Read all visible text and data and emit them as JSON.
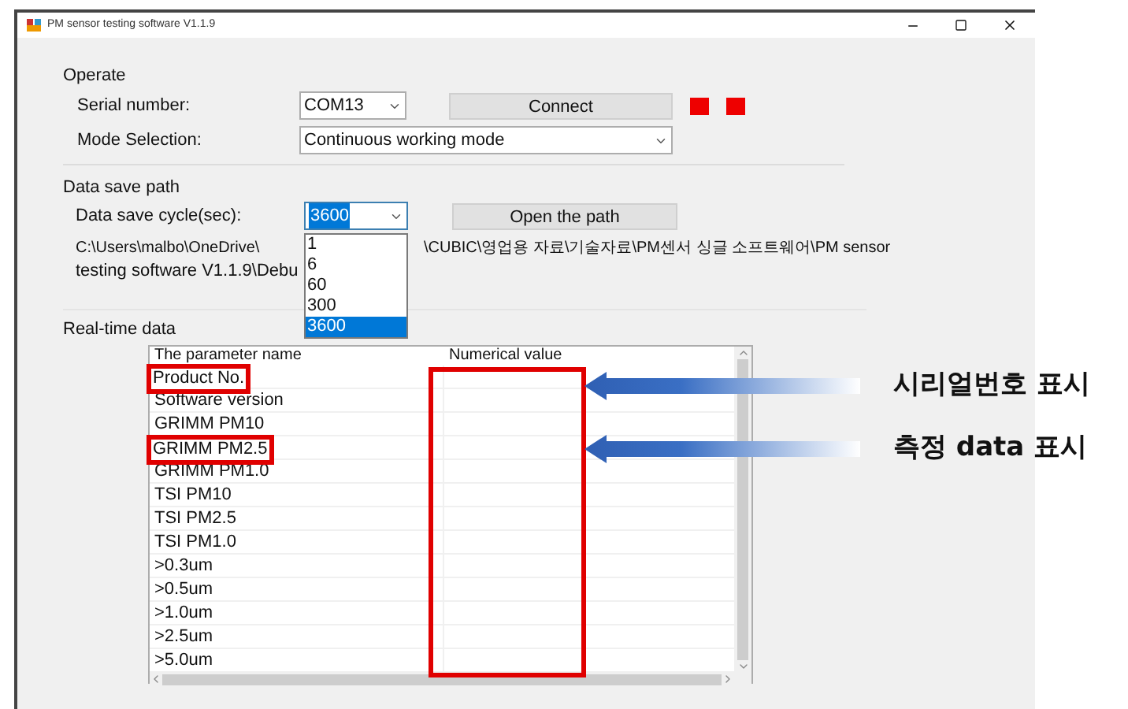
{
  "window": {
    "title": "PM sensor testing software V1.1.9"
  },
  "operate": {
    "title": "Operate",
    "serial_label": "Serial number:",
    "serial_value": "COM13",
    "connect_button": "Connect",
    "status_lights": [
      {
        "color": "#ee0000"
      },
      {
        "color": "#ee0000"
      }
    ],
    "mode_label": "Mode Selection:",
    "mode_value": "Continuous working mode"
  },
  "data_save": {
    "title": "Data save path",
    "cycle_label": "Data save cycle(sec):",
    "cycle_value": "3600",
    "open_button": "Open the path",
    "cycle_options": [
      {
        "label": "1",
        "selected": false
      },
      {
        "label": "6",
        "selected": false
      },
      {
        "label": "60",
        "selected": false
      },
      {
        "label": "300",
        "selected": false
      },
      {
        "label": "3600",
        "selected": true
      }
    ],
    "path_start": "C:\\Users\\malbo\\OneDrive\\",
    "path_end": "\\CUBIC\\영업용 자료\\기술자료\\PM센서 싱글 소프트웨어\\PM sensor",
    "path_line_2": "testing software V1.1.9\\Debu"
  },
  "realtime": {
    "title": "Real-time data",
    "columns": [
      {
        "label": "The parameter name",
        "highlighted": false
      },
      {
        "label": "Numerical value",
        "highlighted": true
      }
    ],
    "rows": [
      {
        "name": "Product No.",
        "highlighted": true
      },
      {
        "name": "Software version",
        "highlighted": false
      },
      {
        "name": "GRIMM PM10",
        "highlighted": false
      },
      {
        "name": "GRIMM PM2.5",
        "highlighted": true
      },
      {
        "name": "GRIMM PM1.0",
        "highlighted": false
      },
      {
        "name": "TSI PM10",
        "highlighted": false
      },
      {
        "name": "TSI PM2.5",
        "highlighted": false
      },
      {
        "name": "TSI PM1.0",
        "highlighted": false
      },
      {
        "name": ">0.3um",
        "highlighted": false
      },
      {
        "name": ">0.5um",
        "highlighted": false
      },
      {
        "name": ">1.0um",
        "highlighted": false
      },
      {
        "name": ">2.5um",
        "highlighted": false
      },
      {
        "name": ">5.0um",
        "highlighted": false
      }
    ]
  },
  "annotations": [
    {
      "label": "시리얼번호 표시"
    },
    {
      "label": "측정 data 표시"
    }
  ]
}
